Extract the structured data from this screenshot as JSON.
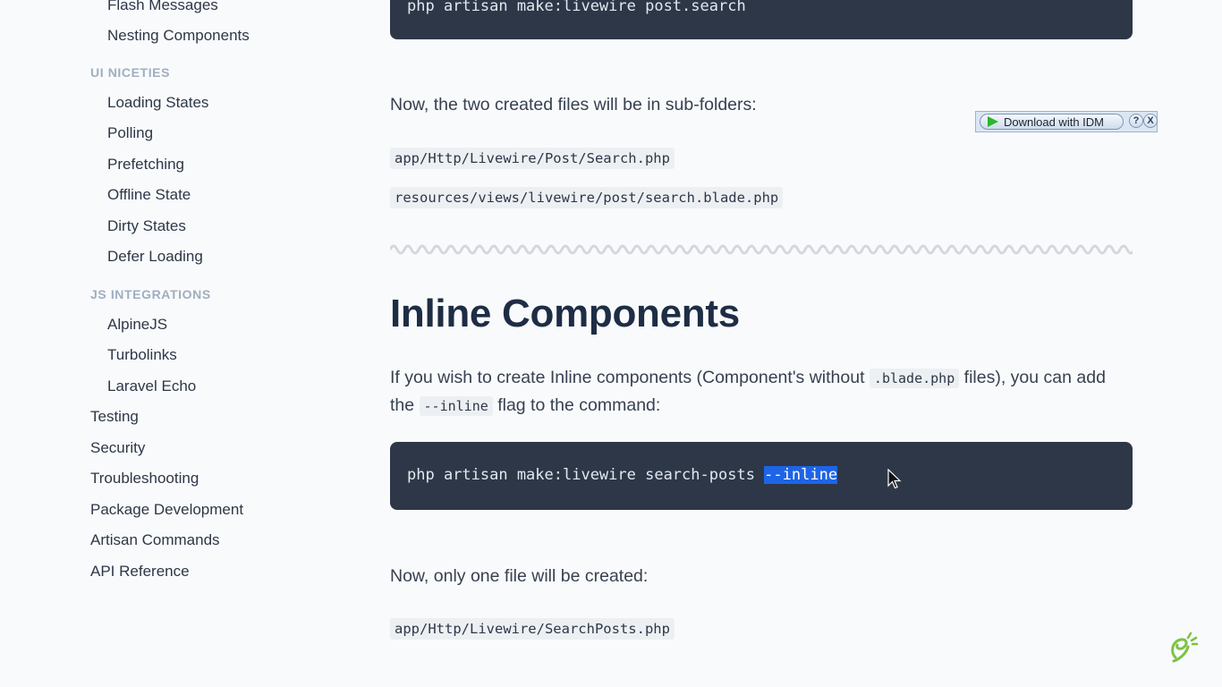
{
  "sidebar": {
    "items": [
      {
        "label": "Flash Messages",
        "type": "sub"
      },
      {
        "label": "Nesting Components",
        "type": "sub"
      },
      {
        "label": "UI NICETIES",
        "type": "heading"
      },
      {
        "label": "Loading States",
        "type": "sub"
      },
      {
        "label": "Polling",
        "type": "sub"
      },
      {
        "label": "Prefetching",
        "type": "sub"
      },
      {
        "label": "Offline State",
        "type": "sub"
      },
      {
        "label": "Dirty States",
        "type": "sub"
      },
      {
        "label": "Defer Loading",
        "type": "sub"
      },
      {
        "label": "JS INTEGRATIONS",
        "type": "heading"
      },
      {
        "label": "AlpineJS",
        "type": "sub"
      },
      {
        "label": "Turbolinks",
        "type": "sub"
      },
      {
        "label": "Laravel Echo",
        "type": "sub"
      },
      {
        "label": "Testing",
        "type": "top"
      },
      {
        "label": "Security",
        "type": "top"
      },
      {
        "label": "Troubleshooting",
        "type": "top"
      },
      {
        "label": "Package Development",
        "type": "top"
      },
      {
        "label": "Artisan Commands",
        "type": "top"
      },
      {
        "label": "API Reference",
        "type": "top"
      }
    ]
  },
  "content": {
    "top_command": "php artisan make:livewire post.search",
    "subfolders_text": "Now, the two created files will be in sub-folders:",
    "file_1": "app/Http/Livewire/Post/Search.php",
    "file_2": "resources/views/livewire/post/search.blade.php",
    "heading": "Inline Components",
    "inline_para": {
      "part1": "If you wish to create Inline components (Component's without ",
      "code1": ".blade.php",
      "part2": " files), you can add the ",
      "code2": "--inline",
      "part3": " flag to the command:"
    },
    "command": {
      "base": "php artisan make:livewire search-posts ",
      "highlighted": "--inline"
    },
    "one_file_text": "Now, only one file will be created:",
    "file_3": "app/Http/Livewire/SearchPosts.php"
  },
  "idm": {
    "download_label": "Download with IDM",
    "help_label": "?",
    "close_label": "X"
  },
  "colors": {
    "code_bg": "#2d3748",
    "heading": "#1e2d45",
    "selection": "#1d64e6",
    "sidebar_heading": "#a0aec0",
    "logo": "#7cc242"
  }
}
